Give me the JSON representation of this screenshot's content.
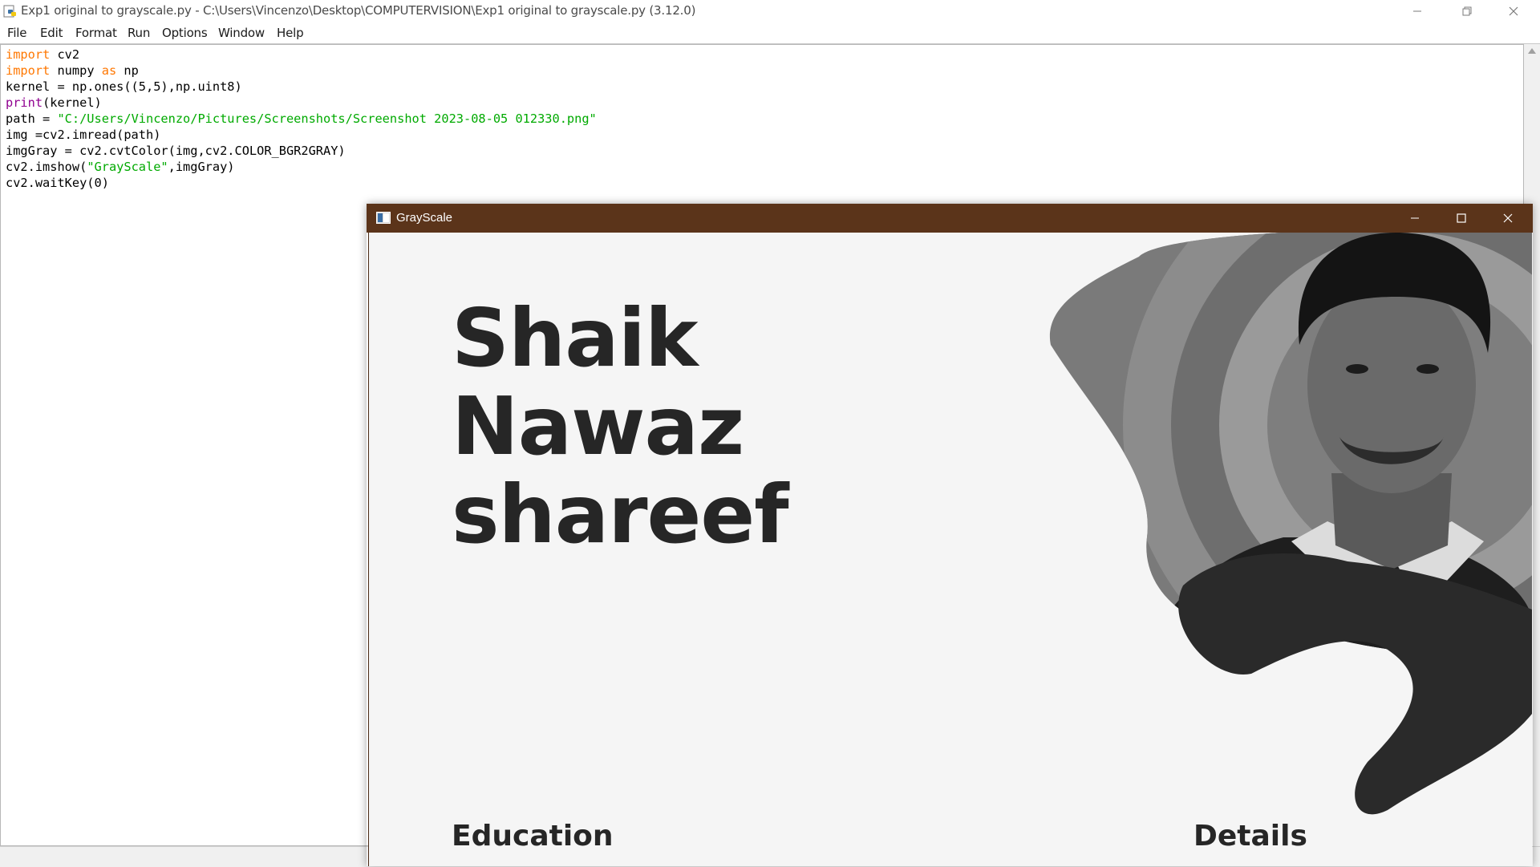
{
  "idle_window": {
    "title": "Exp1 original to grayscale.py - C:\\Users\\Vincenzo\\Desktop\\COMPUTERVISION\\Exp1 original to grayscale.py (3.12.0)",
    "menu": [
      "File",
      "Edit",
      "Format",
      "Run",
      "Options",
      "Window",
      "Help"
    ],
    "code_lines": [
      [
        {
          "t": "import",
          "c": "kw"
        },
        {
          "t": " cv2"
        }
      ],
      [
        {
          "t": "import",
          "c": "kw"
        },
        {
          "t": " numpy "
        },
        {
          "t": "as",
          "c": "kw"
        },
        {
          "t": " np"
        }
      ],
      [
        {
          "t": "kernel = np.ones((5,5),np.uint8)"
        }
      ],
      [
        {
          "t": "print",
          "c": "bi"
        },
        {
          "t": "(kernel)"
        }
      ],
      [
        {
          "t": "path = "
        },
        {
          "t": "\"C:/Users/Vincenzo/Pictures/Screenshots/Screenshot 2023-08-05 012330.png\"",
          "c": "st"
        }
      ],
      [
        {
          "t": "img =cv2.imread(path)"
        }
      ],
      [
        {
          "t": "imgGray = cv2.cvtColor(img,cv2.COLOR_BGR2GRAY)"
        }
      ],
      [
        {
          "t": "cv2.imshow("
        },
        {
          "t": "\"GrayScale\"",
          "c": "st"
        },
        {
          "t": ",imgGray)"
        }
      ],
      [
        {
          "t": "cv2.waitKey(0)"
        }
      ]
    ]
  },
  "grayscale_window": {
    "title": "GrayScale",
    "name_lines": [
      "Shaik",
      "Nawaz",
      "shareef"
    ],
    "section_education": "Education",
    "section_details": "Details"
  },
  "icons": {
    "idle_app": "python-file-icon",
    "minimize": "minimize-icon",
    "maximize": "maximize-icon",
    "restore": "restore-icon",
    "close": "close-icon",
    "opencv_window": "image-window-icon",
    "scroll_up": "scroll-up-arrow-icon"
  },
  "colors": {
    "keyword": "#ff7700",
    "builtin": "#900090",
    "string": "#00aa00",
    "grayscale_titlebar": "#5b341a"
  }
}
